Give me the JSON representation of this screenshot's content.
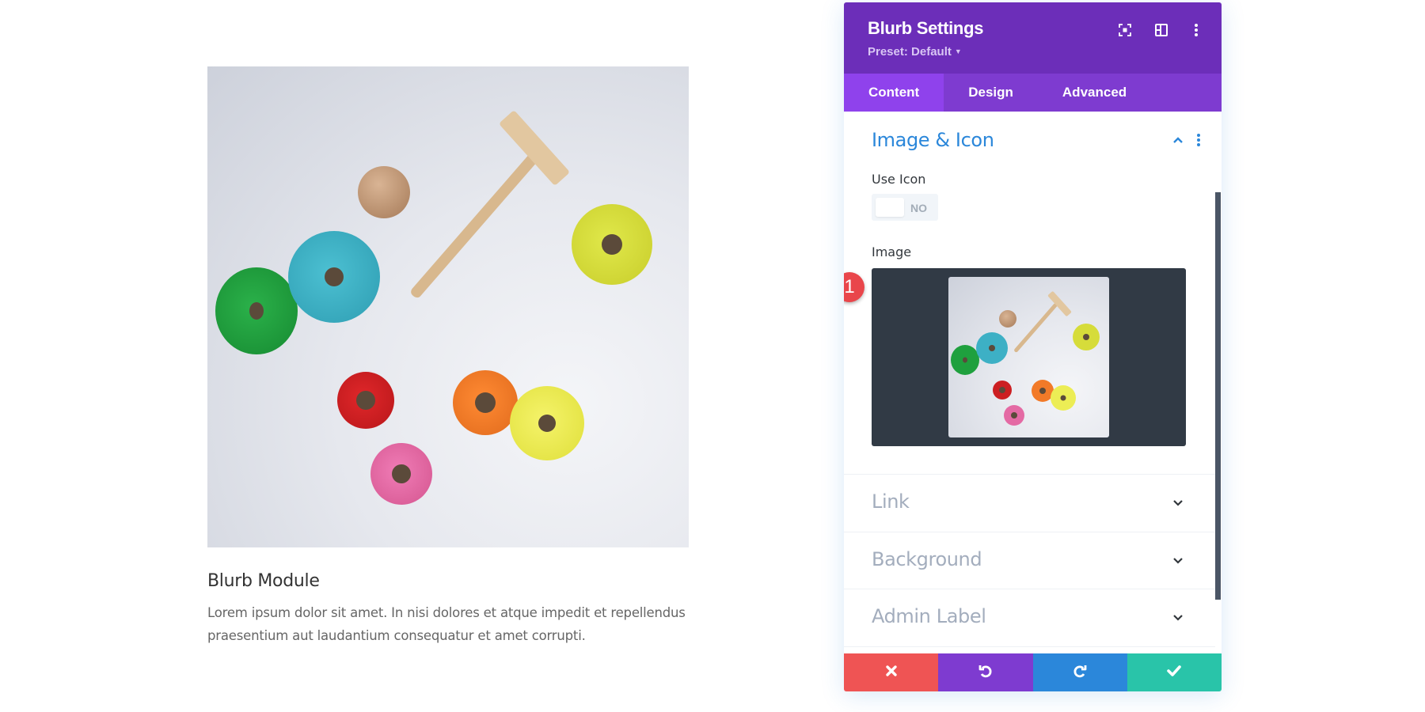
{
  "blurb": {
    "title": "Blurb Module",
    "body": "Lorem ipsum dolor sit amet. In nisi dolores et atque impedit et repellendus praesentium aut laudantium consequatur et amet corrupti."
  },
  "panel": {
    "title": "Blurb Settings",
    "preset_label": "Preset: Default",
    "header_icons": [
      "focus-mode-icon",
      "split-view-icon",
      "more-options-icon"
    ],
    "tabs": [
      {
        "label": "Content",
        "active": true
      },
      {
        "label": "Design",
        "active": false
      },
      {
        "label": "Advanced",
        "active": false
      }
    ],
    "open_section": {
      "title": "Image & Icon",
      "use_icon_label": "Use Icon",
      "use_icon_value": "NO",
      "image_label": "Image",
      "badge": "1"
    },
    "collapsed_sections": [
      {
        "label": "Link"
      },
      {
        "label": "Background"
      },
      {
        "label": "Admin Label"
      }
    ],
    "footer_buttons": [
      {
        "name": "cancel",
        "icon": "close-icon",
        "color": "#ef5454"
      },
      {
        "name": "undo",
        "icon": "undo-icon",
        "color": "#7e3bd0"
      },
      {
        "name": "redo",
        "icon": "redo-icon",
        "color": "#2b87da"
      },
      {
        "name": "save",
        "icon": "check-icon",
        "color": "#29c4a9"
      }
    ]
  },
  "colors": {
    "header_bg": "#6c2eb9",
    "tabs_bg": "#7e3bd0",
    "active_tab_bg": "#8f42ec",
    "section_title": "#2b87da",
    "image_bg": "#313a45",
    "badge": "#e9464b"
  }
}
